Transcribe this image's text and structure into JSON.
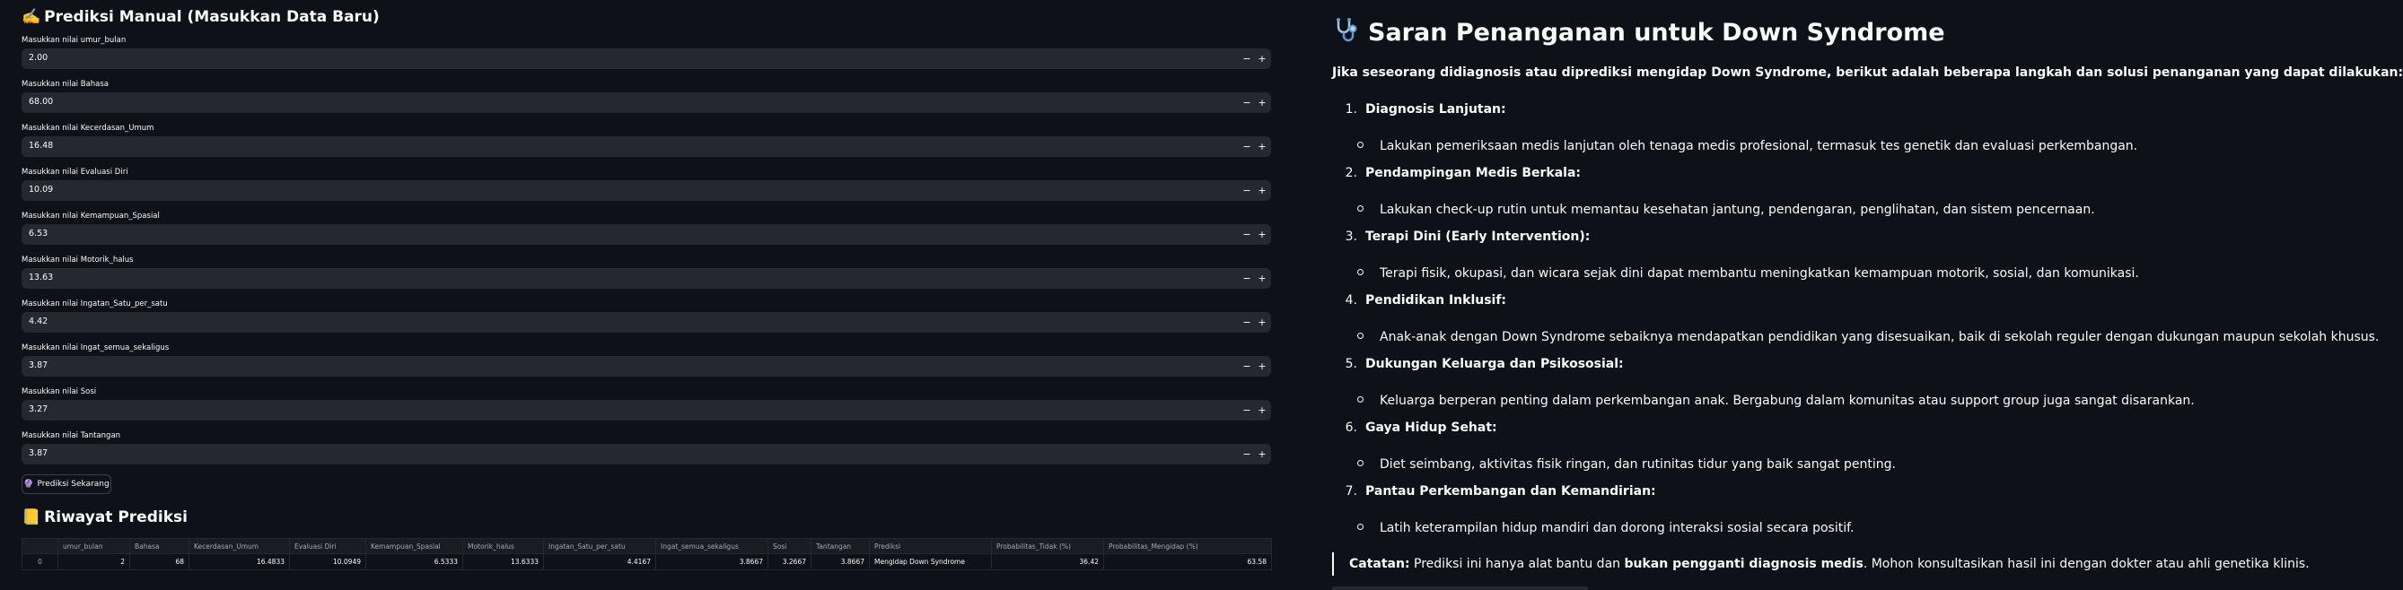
{
  "manual": {
    "title": "Prediksi Manual (Masukkan Data Baru)",
    "title_icon": "writing-hand-icon",
    "fields": [
      {
        "label": "Masukkan nilai umur_bulan",
        "value": "2.00"
      },
      {
        "label": "Masukkan nilai Bahasa",
        "value": "68.00"
      },
      {
        "label": "Masukkan nilai Kecerdasan_Umum",
        "value": "16.48"
      },
      {
        "label": "Masukkan nilai Evaluasi Diri",
        "value": "10.09"
      },
      {
        "label": "Masukkan nilai Kemampuan_Spasial",
        "value": "6.53"
      },
      {
        "label": "Masukkan nilai Motorik_halus",
        "value": "13.63"
      },
      {
        "label": "Masukkan nilai Ingatan_Satu_per_satu",
        "value": "4.42"
      },
      {
        "label": "Masukkan nilai Ingat_semua_sekaligus",
        "value": "3.87"
      },
      {
        "label": "Masukkan nilai Sosi",
        "value": "3.27"
      },
      {
        "label": "Masukkan nilai Tantangan",
        "value": "3.87"
      }
    ],
    "step_minus": "−",
    "step_plus": "+",
    "button_icon": "crystal-ball-icon",
    "button_label": "Prediksi Sekarang"
  },
  "history": {
    "title": "Riwayat Prediksi",
    "title_icon": "ledger-icon",
    "columns": [
      "",
      "umur_bulan",
      "Bahasa",
      "Kecerdasan_Umum",
      "Evaluasi Diri",
      "Kemampuan_Spasial",
      "Motorik_halus",
      "Ingatan_Satu_per_satu",
      "Ingat_semua_sekaligus",
      "Sosi",
      "Tantangan",
      "Prediksi",
      "Probabilitas_Tidak (%)",
      "Probabilitas_Mengidap (%)"
    ],
    "rows": [
      [
        "0",
        "2",
        "68",
        "16.4833",
        "10.0949",
        "6.5333",
        "13.6333",
        "4.4167",
        "3.8667",
        "3.2667",
        "3.8667",
        "Mengidap Down Syndrome",
        "36.42",
        "63.58"
      ]
    ]
  },
  "guide": {
    "title": "Saran Penanganan untuk Down Syndrome",
    "title_icon": "stethoscope-icon",
    "intro": "Jika seseorang didiagnosis atau diprediksi mengidap Down Syndrome, berikut adalah beberapa langkah dan solusi penanganan yang dapat dilakukan:",
    "steps": [
      {
        "num": "1.",
        "title": "Diagnosis Lanjutan:",
        "item": "Lakukan pemeriksaan medis lanjutan oleh tenaga medis profesional, termasuk tes genetik dan evaluasi perkembangan."
      },
      {
        "num": "2.",
        "title": "Pendampingan Medis Berkala:",
        "item": "Lakukan check-up rutin untuk memantau kesehatan jantung, pendengaran, penglihatan, dan sistem pencernaan."
      },
      {
        "num": "3.",
        "title": "Terapi Dini (Early Intervention):",
        "item": "Terapi fisik, okupasi, dan wicara sejak dini dapat membantu meningkatkan kemampuan motorik, sosial, dan komunikasi."
      },
      {
        "num": "4.",
        "title": "Pendidikan Inklusif:",
        "item": "Anak-anak dengan Down Syndrome sebaiknya mendapatkan pendidikan yang disesuaikan, baik di sekolah reguler dengan dukungan maupun sekolah khusus."
      },
      {
        "num": "5.",
        "title": "Dukungan Keluarga dan Psikososial:",
        "item": "Keluarga berperan penting dalam perkembangan anak. Bergabung dalam komunitas atau support group juga sangat disarankan."
      },
      {
        "num": "6.",
        "title": "Gaya Hidup Sehat:",
        "item": "Diet seimbang, aktivitas fisik ringan, dan rutinitas tidur yang baik sangat penting."
      },
      {
        "num": "7.",
        "title": "Pantau Perkembangan dan Kemandirian:",
        "item": "Latih keterampilan hidup mandiri dan dorong interaksi sosial secara positif."
      }
    ],
    "note_label": "Catatan:",
    "note_text1": " Prediksi ini hanya alat bantu dan ",
    "note_bold": "bukan pengganti diagnosis medis",
    "note_text2": ". Mohon konsultasikan hasil ini dengan dokter atau ahli genetika klinis."
  }
}
